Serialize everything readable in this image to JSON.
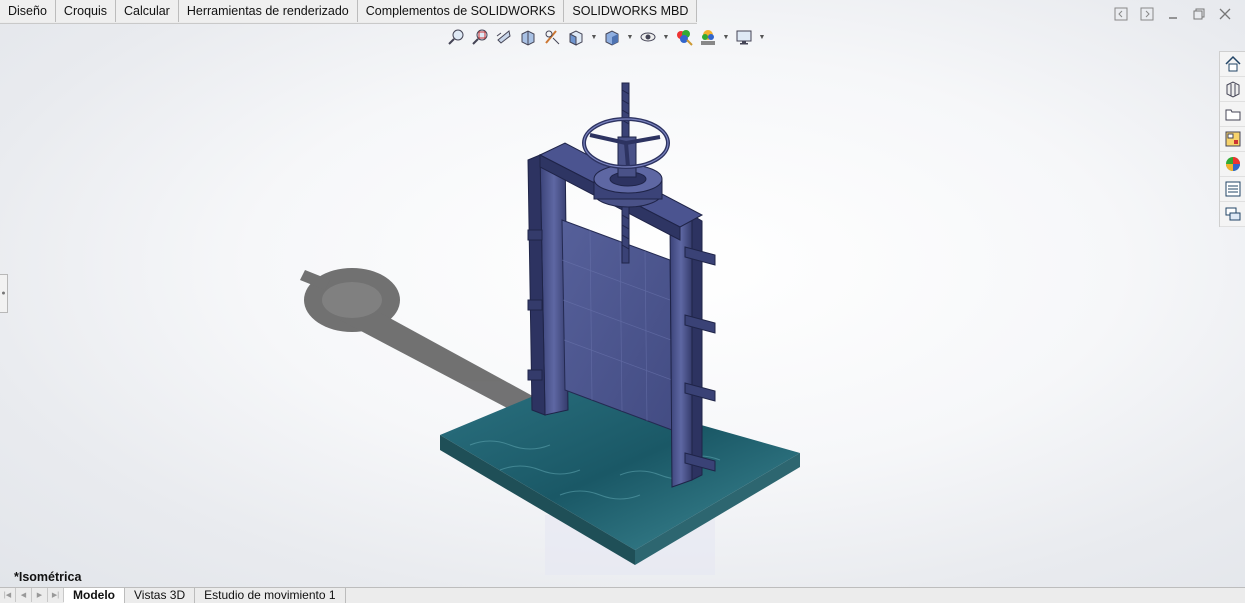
{
  "command_tabs": [
    {
      "label": "Diseño"
    },
    {
      "label": "Croquis"
    },
    {
      "label": "Calcular"
    },
    {
      "label": "Herramientas de renderizado"
    },
    {
      "label": "Complementos de SOLIDWORKS"
    },
    {
      "label": "SOLIDWORKS MBD"
    }
  ],
  "view_toolbar_icons": [
    "zoom-to-fit-icon",
    "zoom-to-area-icon",
    "previous-view-icon",
    "section-view-icon",
    "dynamic-annotation-icon",
    "view-orientation-icon",
    "display-style-icon",
    "hide-show-items-icon",
    "edit-appearance-icon",
    "apply-scene-icon",
    "view-settings-icon"
  ],
  "task_pane_icons": [
    "home-icon",
    "design-library-icon",
    "file-explorer-icon",
    "view-palette-icon",
    "appearances-icon",
    "custom-properties-icon",
    "forum-icon"
  ],
  "view_orientation_label": "*Isométrica",
  "bottom_tabs": [
    {
      "label": "Modelo",
      "active": true
    },
    {
      "label": "Vistas 3D",
      "active": false
    },
    {
      "label": "Estudio de movimiento 1",
      "active": false
    }
  ],
  "colors": {
    "model_metal": "#4a5288",
    "model_dark": "#2a2f55",
    "water_base": "#1f5f6b",
    "shadow": "#555555"
  }
}
